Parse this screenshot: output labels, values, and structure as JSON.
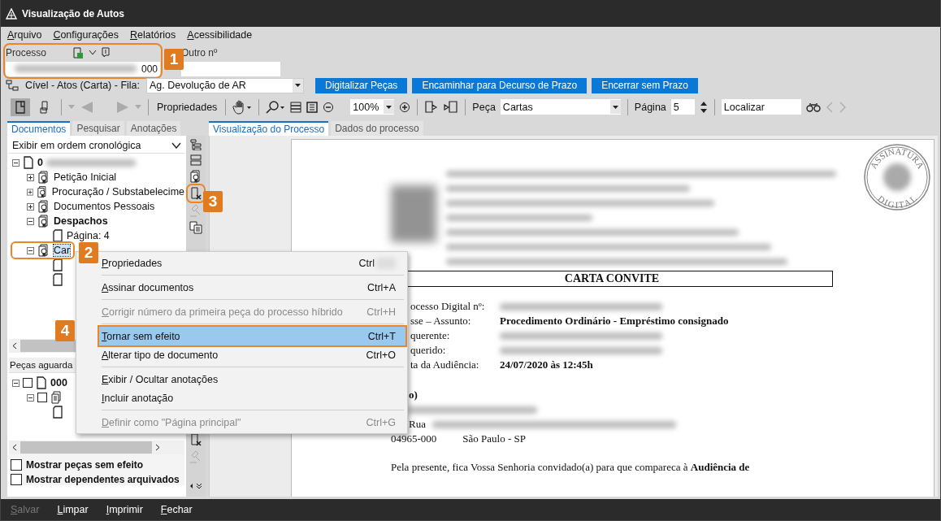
{
  "window": {
    "title": "Visualização de Autos"
  },
  "menu": [
    "Arquivo",
    "Configurações",
    "Relatórios",
    "Acessibilidade"
  ],
  "processo": {
    "label": "Processo",
    "value": "000",
    "redacted": true
  },
  "outro": {
    "label": "Outro nº"
  },
  "fila": {
    "label": "Cível - Atos (Carta) - Fila:",
    "value": "Ag. Devolução de AR"
  },
  "action_buttons": [
    "Digitalizar Peças",
    "Encaminhar para Decurso de Prazo",
    "Encerrar sem Prazo"
  ],
  "toolbar": {
    "view_toggles": [
      {
        "selected": true
      },
      {
        "selected": false
      }
    ],
    "properties": "Propriedades",
    "zoom": "100%",
    "piece_label": "Peça",
    "piece": "Cartas",
    "page_label": "Página",
    "page": "5",
    "search": "Localizar"
  },
  "left_tabs": [
    {
      "label": "Documentos",
      "selected": true
    },
    {
      "label": "Pesquisar",
      "selected": false
    },
    {
      "label": "Anotações",
      "selected": false
    }
  ],
  "order_select": "Exibir em ordem cronológica",
  "document_tree": [
    {
      "label": "0",
      "kind": "document",
      "redacted": true,
      "bold": true,
      "expanded": true,
      "selected": false,
      "children": [
        {
          "label": "Petição Inicial",
          "kind": "certified",
          "bold": false,
          "expanded": false,
          "selected": false
        },
        {
          "label": "Procuração / Substabelecime",
          "kind": "certified",
          "bold": false,
          "expanded": false,
          "selected": false
        },
        {
          "label": "Documentos Pessoais",
          "kind": "certified",
          "bold": false,
          "expanded": false,
          "selected": false
        },
        {
          "label": "Despachos",
          "kind": "certified",
          "bold": true,
          "expanded": true,
          "selected": false,
          "children": [
            {
              "label": "Página: 4",
              "kind": "page",
              "bold": false,
              "selected": false
            }
          ]
        },
        {
          "label": "Car",
          "kind": "certified",
          "bold": false,
          "expanded": true,
          "selected": true,
          "children": [
            {
              "kind": "page"
            },
            {
              "kind": "page"
            }
          ]
        }
      ]
    }
  ],
  "pending": {
    "title": "Peças aguarda",
    "tree": [
      {
        "label": "000",
        "kind": "document",
        "bold": true,
        "expanded": true,
        "checked": false,
        "children": [
          {
            "kind": "stack",
            "expanded": true,
            "checked": false,
            "children": [
              {
                "kind": "page"
              }
            ]
          }
        ]
      }
    ]
  },
  "options": [
    {
      "label": "Mostrar peças sem efeito",
      "checked": false
    },
    {
      "label": "Mostrar dependentes arquivados",
      "checked": false
    }
  ],
  "viewer_tabs": [
    {
      "label": "Visualização do Processo",
      "selected": true
    },
    {
      "label": "Dados do processo",
      "selected": false
    }
  ],
  "document": {
    "stamp": [
      "ASSINATURA",
      "DIGITAL"
    ],
    "title": "CARTA CONVITE",
    "fields": [
      {
        "label": "ocesso Digital nº:",
        "redacted": true
      },
      {
        "label": "sse – Assunto:",
        "value": "Procedimento Ordinário - Empréstimo consignado",
        "redacted": false
      },
      {
        "label": "querente:",
        "redacted": true
      },
      {
        "label": "querido:",
        "redacted": true
      },
      {
        "label": "ta da Audiência:",
        "value": "24/07/2020 às 12:45h",
        "redacted": false
      }
    ],
    "recipient": "o)",
    "street": "Rua",
    "zip": "04965-000",
    "city": "São Paulo - SP",
    "paragraph": "Pela presente, fica Vossa Senhoria convidado(a) para que compareca à **Audiência de**"
  },
  "context_menu": [
    {
      "kind": "item",
      "label": "Propriedades",
      "shortcut": "Ctrl",
      "redacted": true,
      "disabled": false,
      "selected": false
    },
    {
      "kind": "separator"
    },
    {
      "kind": "item",
      "label": "Assinar documentos",
      "shortcut": "Ctrl+A",
      "redacted": false,
      "disabled": false,
      "selected": false
    },
    {
      "kind": "separator"
    },
    {
      "kind": "item",
      "label": "Corrigir número da primeira peça do processo híbrido",
      "shortcut": "Ctrl+H",
      "redacted": false,
      "disabled": true,
      "selected": false
    },
    {
      "kind": "separator"
    },
    {
      "kind": "item",
      "label": "Tornar sem efeito",
      "shortcut": "Ctrl+T",
      "redacted": false,
      "disabled": false,
      "selected": true
    },
    {
      "kind": "item",
      "label": "Alterar tipo de documento",
      "shortcut": "Ctrl+O",
      "redacted": false,
      "disabled": false,
      "selected": false
    },
    {
      "kind": "separator"
    },
    {
      "kind": "item",
      "label": "Exibir / Ocultar anotações",
      "disabled": false,
      "selected": false
    },
    {
      "kind": "item",
      "label": "Incluir anotação",
      "disabled": false,
      "selected": false
    },
    {
      "kind": "separator"
    },
    {
      "kind": "item",
      "label": "Definir como \"Página principal\"",
      "shortcut": "Ctrl+G",
      "redacted": false,
      "disabled": true,
      "selected": false
    }
  ],
  "callouts": [
    "1",
    "2",
    "3",
    "4"
  ],
  "footer": [
    {
      "label": "Salvar",
      "disabled": true
    },
    {
      "label": "Limpar",
      "disabled": false
    },
    {
      "label": "Imprimir",
      "disabled": false
    },
    {
      "label": "Fechar",
      "disabled": false
    }
  ]
}
